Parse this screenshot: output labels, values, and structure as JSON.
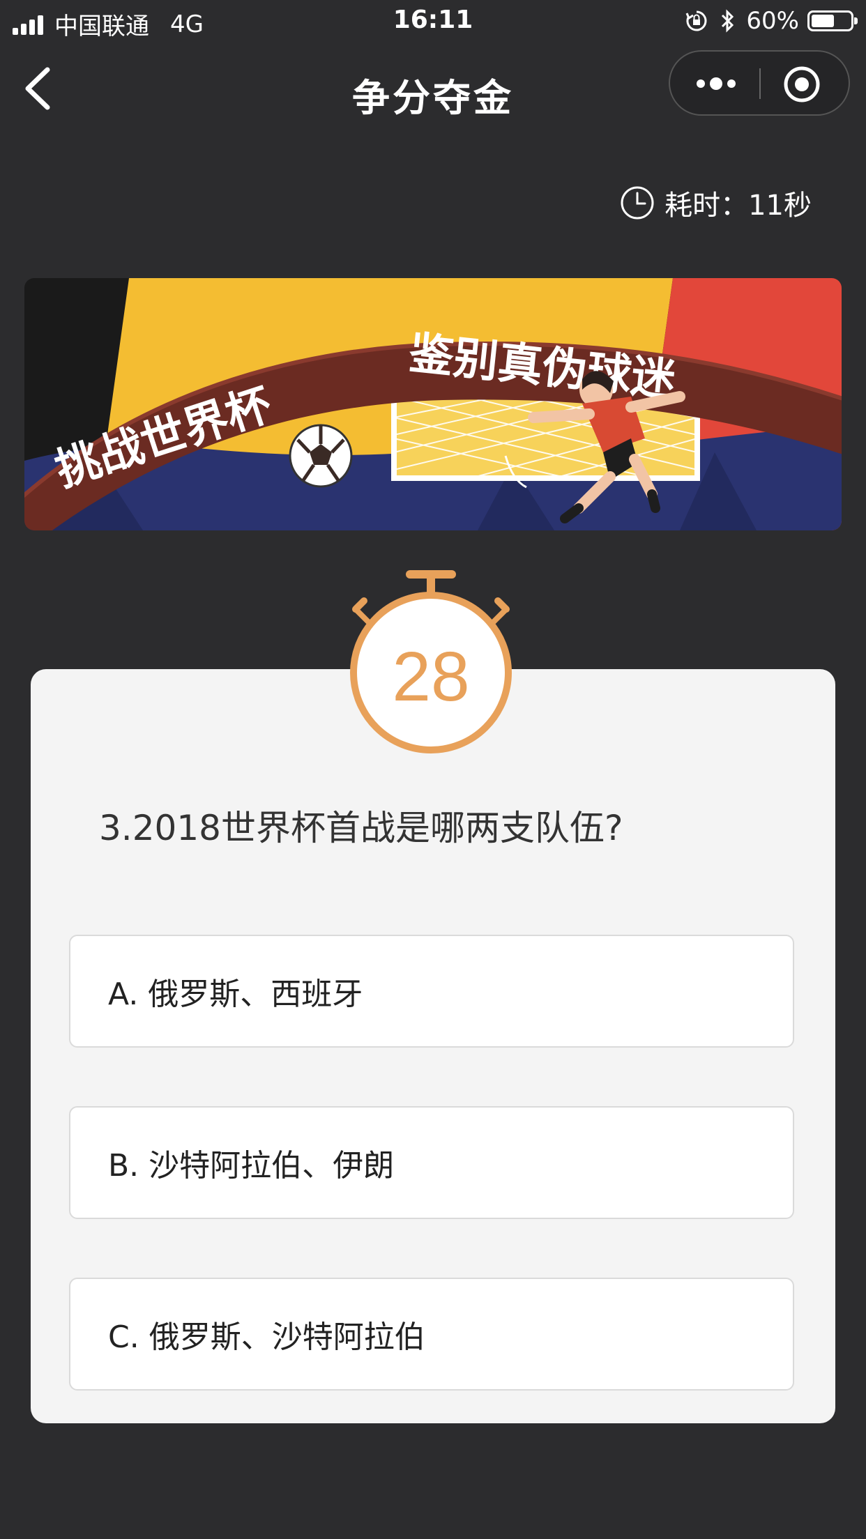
{
  "status_bar": {
    "carrier": "中国联通",
    "network": "4G",
    "time": "16:11",
    "battery_percent": "60%",
    "battery_level": 0.6
  },
  "nav": {
    "title": "争分夺金",
    "back_icon": "chevron-left-icon",
    "more_icon": "more-dots-icon",
    "close_icon": "target-close-icon"
  },
  "elapsed": {
    "label": "耗时：",
    "value": "11秒"
  },
  "banner": {
    "text_left": "挑战世界杯",
    "text_right": "鉴别真伪球迷"
  },
  "timer": {
    "seconds": "28",
    "color": "#e8a15a"
  },
  "question": {
    "text": "3.2018世界杯首战是哪两支队伍?"
  },
  "options": [
    {
      "label": "A. 俄罗斯、西班牙"
    },
    {
      "label": "B. 沙特阿拉伯、伊朗"
    },
    {
      "label": "C. 俄罗斯、沙特阿拉伯"
    }
  ],
  "colors": {
    "background": "#2c2c2e",
    "card": "#f4f4f4",
    "accent": "#e8a15a"
  }
}
